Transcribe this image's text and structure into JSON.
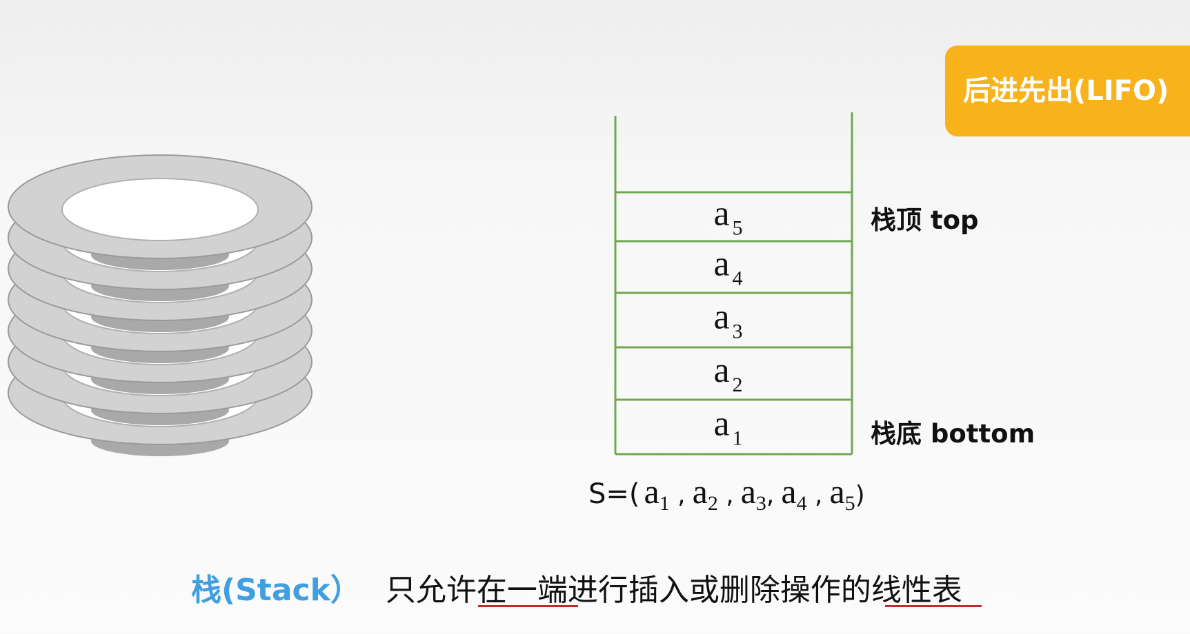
{
  "badge": {
    "text": "后进先出(LIFO)"
  },
  "stack": {
    "cells": [
      {
        "base": "a",
        "sub": "5"
      },
      {
        "base": "a",
        "sub": "4"
      },
      {
        "base": "a",
        "sub": "3"
      },
      {
        "base": "a",
        "sub": "2"
      },
      {
        "base": "a",
        "sub": "1"
      }
    ],
    "top_label": "栈顶 top",
    "bottom_label": "栈底 bottom"
  },
  "sequence": {
    "prefix": "S=(",
    "items": [
      {
        "base": "a",
        "sub": "1",
        "sep": " ,"
      },
      {
        "base": "a",
        "sub": "2",
        "sep": " ,"
      },
      {
        "base": "a",
        "sub": "3",
        "sep": ","
      },
      {
        "base": "a",
        "sub": "4",
        "sep": " ,"
      },
      {
        "base": "a",
        "sub": "5",
        "sep": ")"
      }
    ]
  },
  "definition": {
    "term": "栈(Stack）",
    "text": "只允许在一端进行插入或删除操作的线性表"
  },
  "colors": {
    "badge": "#f7b21c",
    "stack_border": "#6fa84f",
    "term": "#3f9fe0",
    "underline": "#c62828",
    "plate_rim": "#d2d2d2",
    "plate_inner": "#ffffff",
    "plate_shadow": "#a9a9a9"
  },
  "illustration": {
    "plate_count": 7
  }
}
